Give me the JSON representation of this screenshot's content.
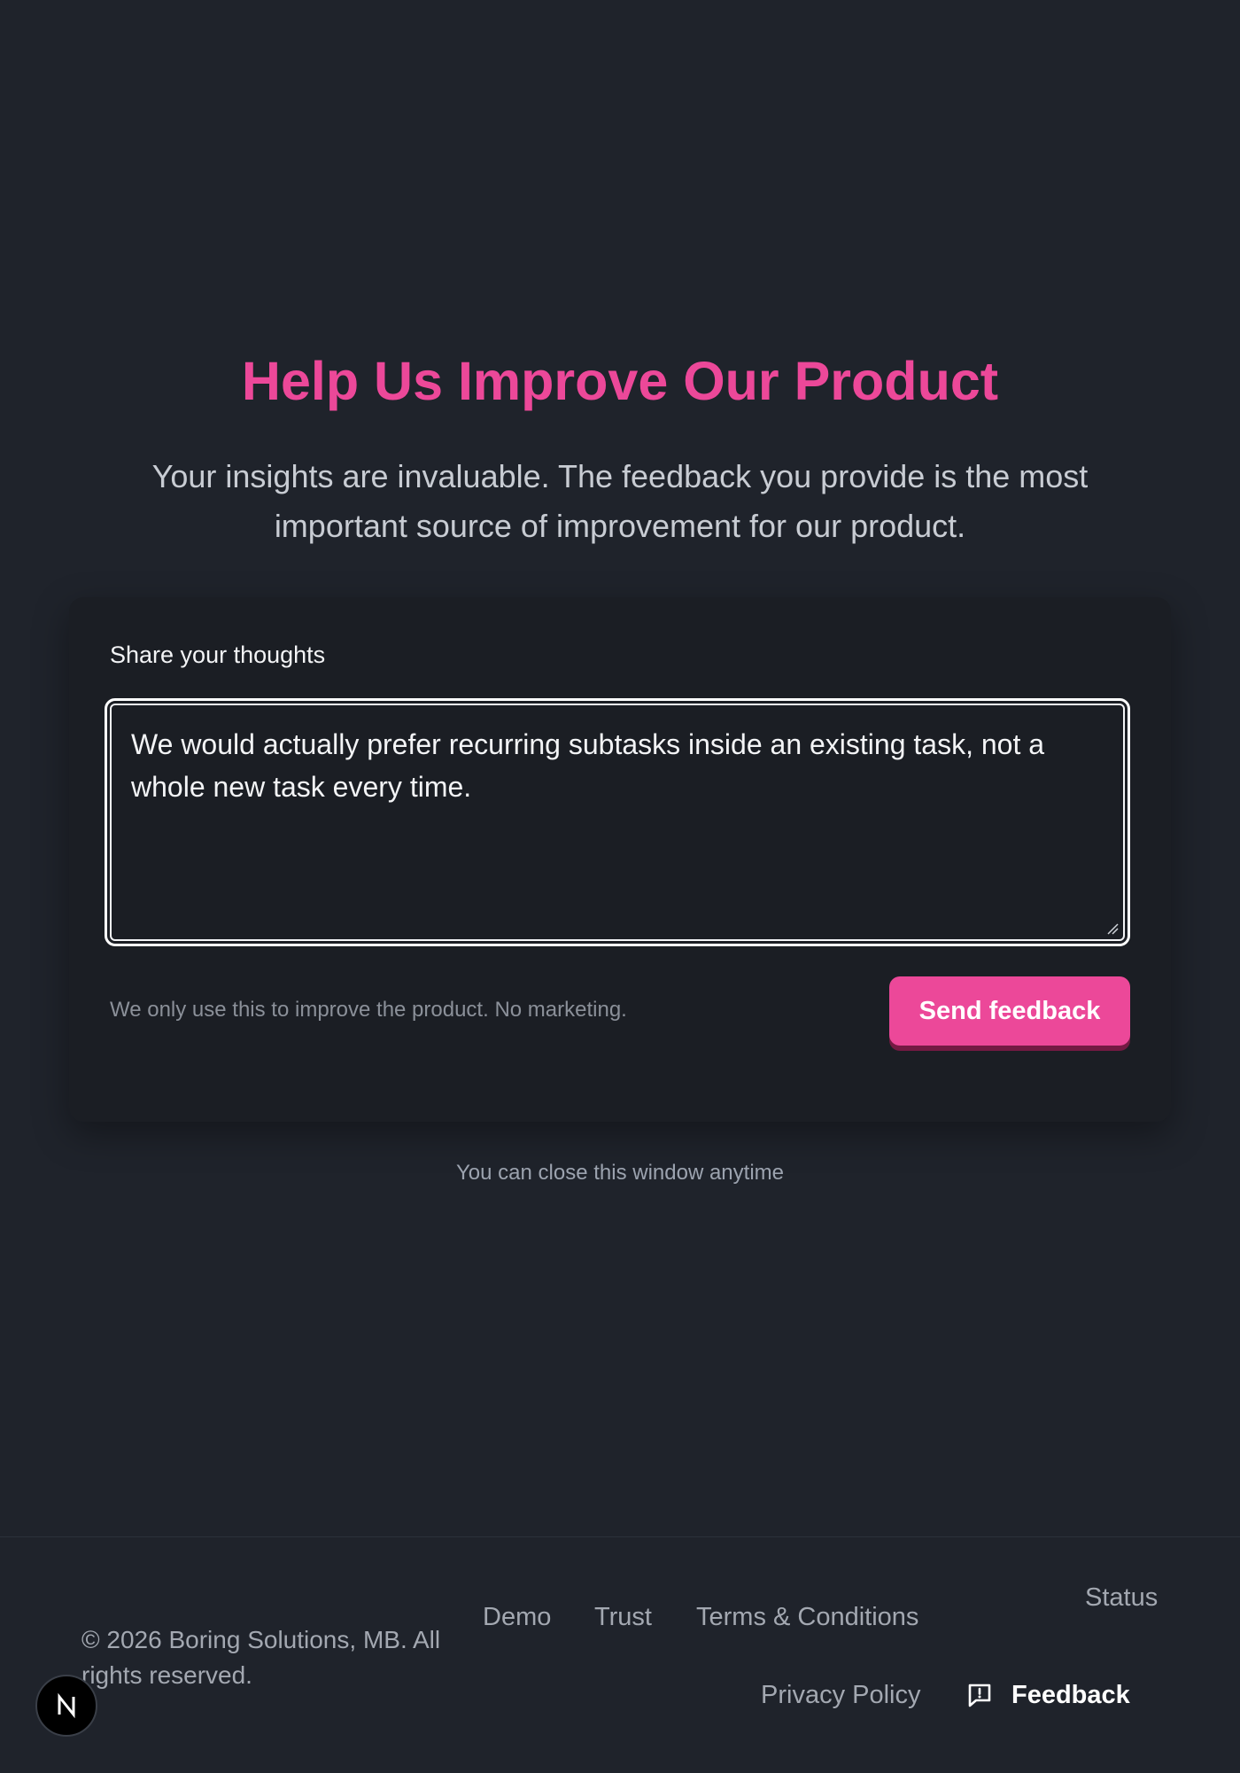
{
  "hero": {
    "title": "Help Us Improve Our Product",
    "subtitle": "Your insights are invaluable. The feedback you provide is the most important source of improvement for our product."
  },
  "form": {
    "label": "Share your thoughts",
    "textarea_value": "We would actually prefer recurring subtasks inside an existing task, not a whole new task every time.",
    "note": "We only use this to improve the product. No marketing.",
    "submit_label": "Send feedback"
  },
  "close_hint": "You can close this window anytime",
  "footer": {
    "copyright": "© 2026 Boring Solutions, MB. All rights reserved.",
    "links": {
      "demo": "Demo",
      "trust": "Trust",
      "terms": "Terms & Conditions",
      "status": "Status",
      "privacy": "Privacy Policy"
    },
    "feedback_label": "Feedback"
  },
  "badge": {
    "letter": "N"
  },
  "colors": {
    "accent": "#ec4899",
    "background": "#1f232b",
    "card": "#1b1e24"
  },
  "icons": {
    "feedback": "message-alert-icon",
    "badge": "next-logo-icon"
  }
}
